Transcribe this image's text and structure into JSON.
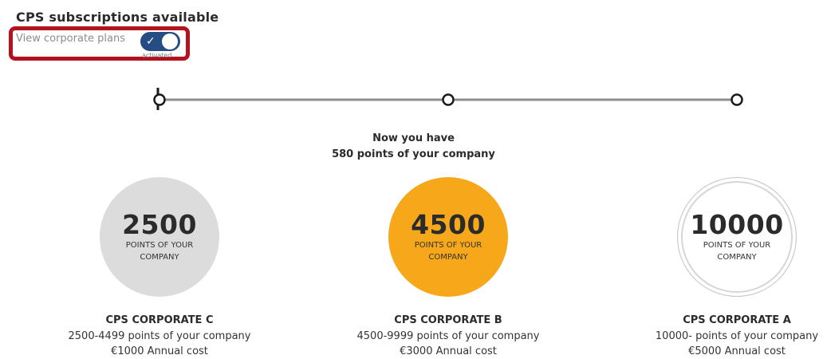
{
  "header": {
    "title": "CPS subscriptions available"
  },
  "toggle": {
    "label": "View corporate plans",
    "status": "activated",
    "on": true,
    "check_icon": "check-icon",
    "accent_color": "#264d83",
    "highlight_color": "#b3121f"
  },
  "progress": {
    "line1": "Now you have",
    "line2": "580 points of your company",
    "current_points": 580,
    "milestones": [
      2500,
      4500,
      10000
    ]
  },
  "plans": [
    {
      "points": "2500",
      "unit": "POINTS OF YOUR COMPANY",
      "name": "CPS CORPORATE C",
      "range": "2500-4499 points of your company",
      "cost": "€1000 Annual cost",
      "color": "#dcdcdc"
    },
    {
      "points": "4500",
      "unit": "POINTS OF YOUR COMPANY",
      "name": "CPS CORPORATE B",
      "range": "4500-9999 points of your company",
      "cost": "€3000 Annual cost",
      "color": "#f6a81a"
    },
    {
      "points": "10000",
      "unit": "POINTS OF YOUR COMPANY",
      "name": "CPS CORPORATE A",
      "range": "10000- points of your company",
      "cost": "€5000 Annual cost",
      "color": "#ffffff"
    }
  ]
}
